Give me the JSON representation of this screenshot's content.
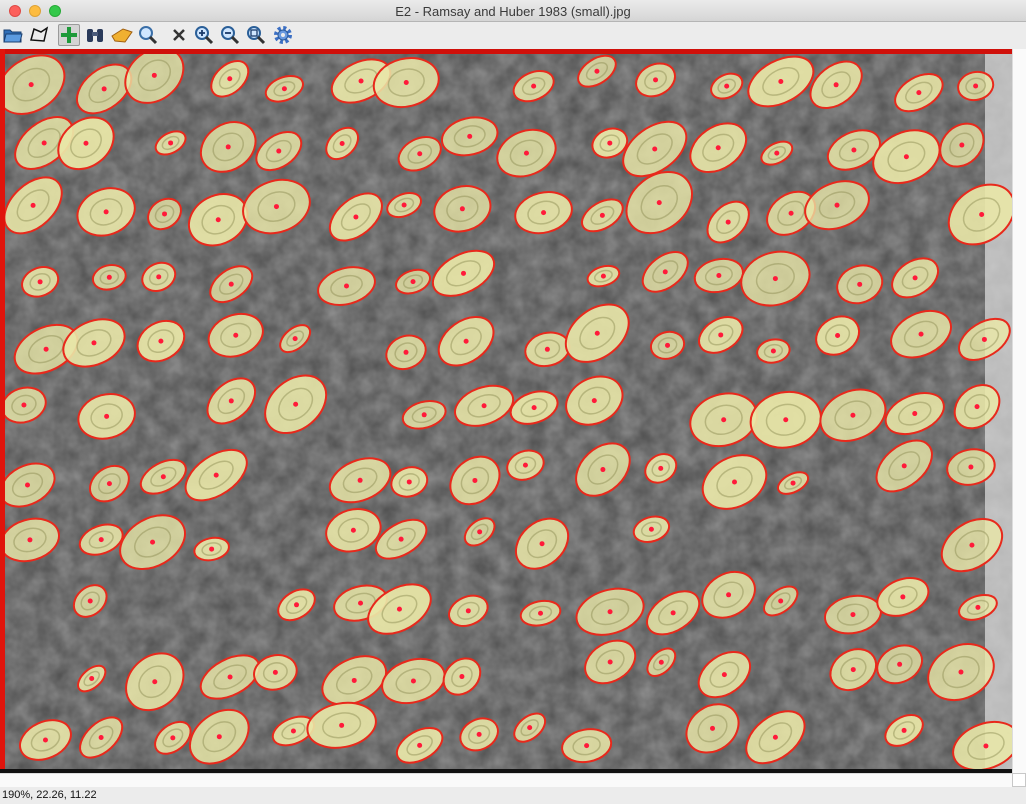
{
  "window": {
    "title": "E2 - Ramsay and Huber 1983 (small).jpg"
  },
  "toolbar": {
    "tools": [
      {
        "icon": "folder-open-icon",
        "name": "open-tool",
        "active": false
      },
      {
        "icon": "polygon-select-icon",
        "name": "polygon-tool",
        "active": false
      },
      {
        "icon": "plus-icon",
        "name": "add-tool",
        "active": true
      },
      {
        "icon": "binoculars-icon",
        "name": "find-tool",
        "active": false
      },
      {
        "icon": "pointer-hand-icon",
        "name": "pointer-tool",
        "active": false
      },
      {
        "icon": "magnifier-icon",
        "name": "magnify-tool",
        "active": false
      },
      {
        "icon": "close-x-icon",
        "name": "delete-tool",
        "active": false
      },
      {
        "icon": "zoom-in-icon",
        "name": "zoom-in-tool",
        "active": false
      },
      {
        "icon": "zoom-out-icon",
        "name": "zoom-out-tool",
        "active": false
      },
      {
        "icon": "zoom-fit-icon",
        "name": "zoom-fit-tool",
        "active": false
      },
      {
        "icon": "gear-icon",
        "name": "settings-tool",
        "active": false
      }
    ]
  },
  "colors": {
    "ellipse_stroke": "#e8291c",
    "ellipse_fill": "#e9e7a8",
    "center_dot": "#ff1a3a",
    "rock_bg": "#5a5a5a"
  },
  "image": {
    "description_icon": "ooid-thin-section-image"
  },
  "status": {
    "text": "190%, 22.26, 11.22"
  }
}
